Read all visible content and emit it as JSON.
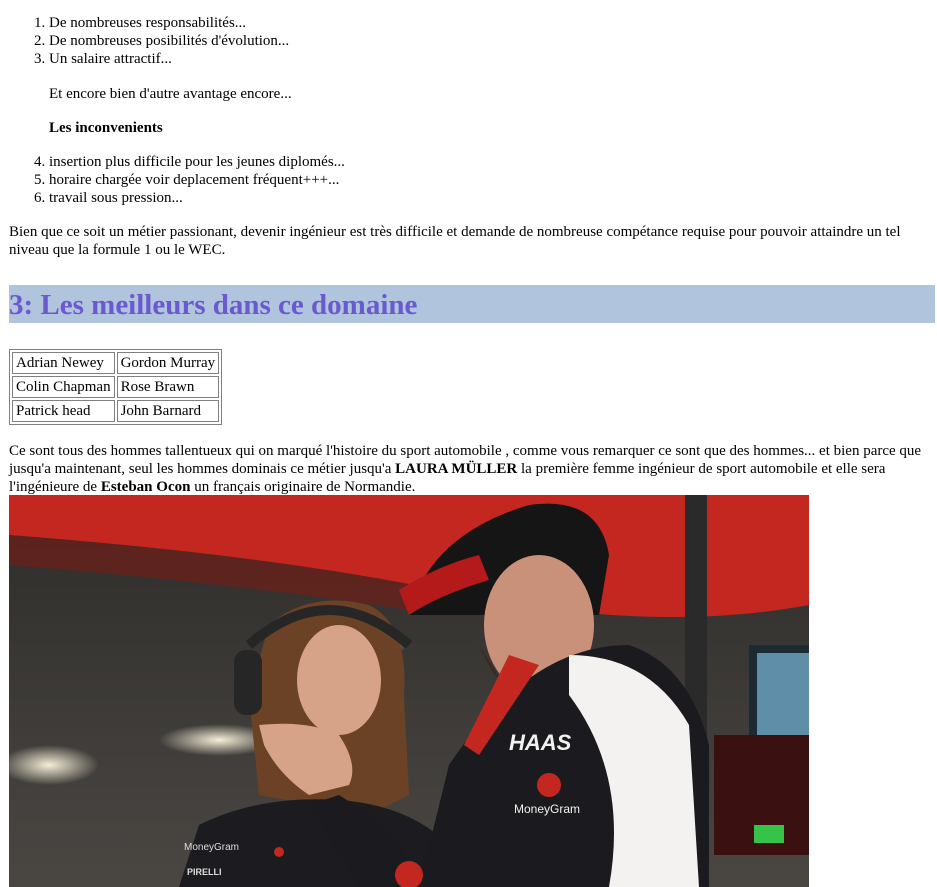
{
  "advantages": [
    "De nombreuses responsabilités...",
    "De nombreuses posibilités d'évolution...",
    "Un salaire attractif..."
  ],
  "more_advantages": "Et encore bien d'autre avantage encore...",
  "inconvenients_heading": "Les inconvenients",
  "inconvenients": [
    "insertion plus difficile pour les jeunes diplomés...",
    "horaire chargée voir deplacement fréquent+++...",
    "travail sous pression..."
  ],
  "paragraph_1": "Bien que ce soit un métier passionant, devenir ingénieur est très difficile et demande de nombreuse compétance requise pour pouvoir attaindre un tel niveau que la formule 1 ou le WEC.",
  "section_heading": "3: Les meilleurs dans ce domaine",
  "table": [
    [
      "Adrian Newey",
      "Gordon Murray"
    ],
    [
      "Colin Chapman",
      "Rose Brawn"
    ],
    [
      "Patrick head",
      "John Barnard"
    ]
  ],
  "paragraph_2": {
    "part1": "Ce sont tous des hommes tallentueux qui on marqué l'histoire du sport automobile , comme vous remarquer ce sont que des hommes... et bien parce que jusqu'a maintenant, seul les hommes dominais ce métier jusqu'a ",
    "bold1": "LAURA MÜLLER",
    "part2": " la première femme ingénieur de sport automobile et elle sera l'ingénieure de ",
    "bold2": "Esteban Ocon",
    "part3": " un français originaire de Normandie."
  },
  "photo": {
    "caption_in_image": [
      "HAAS",
      "MoneyGram",
      "MoneyGram",
      "PIRELLI"
    ],
    "colors": {
      "garage_red": "#c4271f",
      "suit_black": "#1b1b1f",
      "suit_white": "#f3f2f0",
      "skin": "#c99179"
    }
  }
}
